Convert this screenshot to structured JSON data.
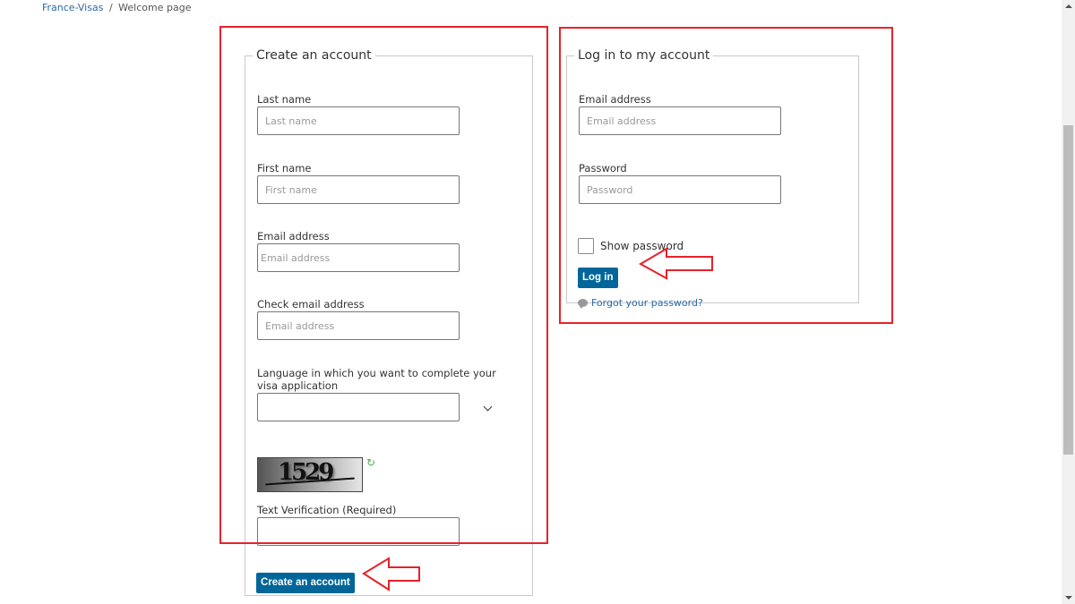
{
  "breadcrumb": {
    "home": "France-Visas",
    "separator": "/",
    "current": "Welcome page"
  },
  "create_account": {
    "legend": "Create an account",
    "fields": {
      "last_name": {
        "label": "Last name",
        "placeholder": "Last name",
        "value": ""
      },
      "first_name": {
        "label": "First name",
        "placeholder": "First name",
        "value": ""
      },
      "email": {
        "label": "Email address",
        "placeholder": "Email address",
        "value": ""
      },
      "check_email": {
        "label": "Check email address",
        "placeholder": "Email address",
        "value": ""
      },
      "language": {
        "label": "Language in which you want to complete your visa application",
        "selected": ""
      },
      "captcha_text": {
        "label": "Text Verification (Required)",
        "value": ""
      }
    },
    "captcha": {
      "code": "1529",
      "refresh_icon": "refresh-icon"
    },
    "submit_label": "Create an account"
  },
  "login": {
    "legend": "Log in to my account",
    "fields": {
      "email": {
        "label": "Email address",
        "placeholder": "Email address",
        "value": ""
      },
      "password": {
        "label": "Password",
        "placeholder": "Password",
        "value": ""
      }
    },
    "show_password_label": "Show password",
    "show_password_checked": false,
    "submit_label": "Log in",
    "forgot_label": "Forgot your password?",
    "forgot_icon": "speech-bubble-icon"
  },
  "annotations": {
    "highlight_color": "#e8212b",
    "button_color": "#006699"
  }
}
